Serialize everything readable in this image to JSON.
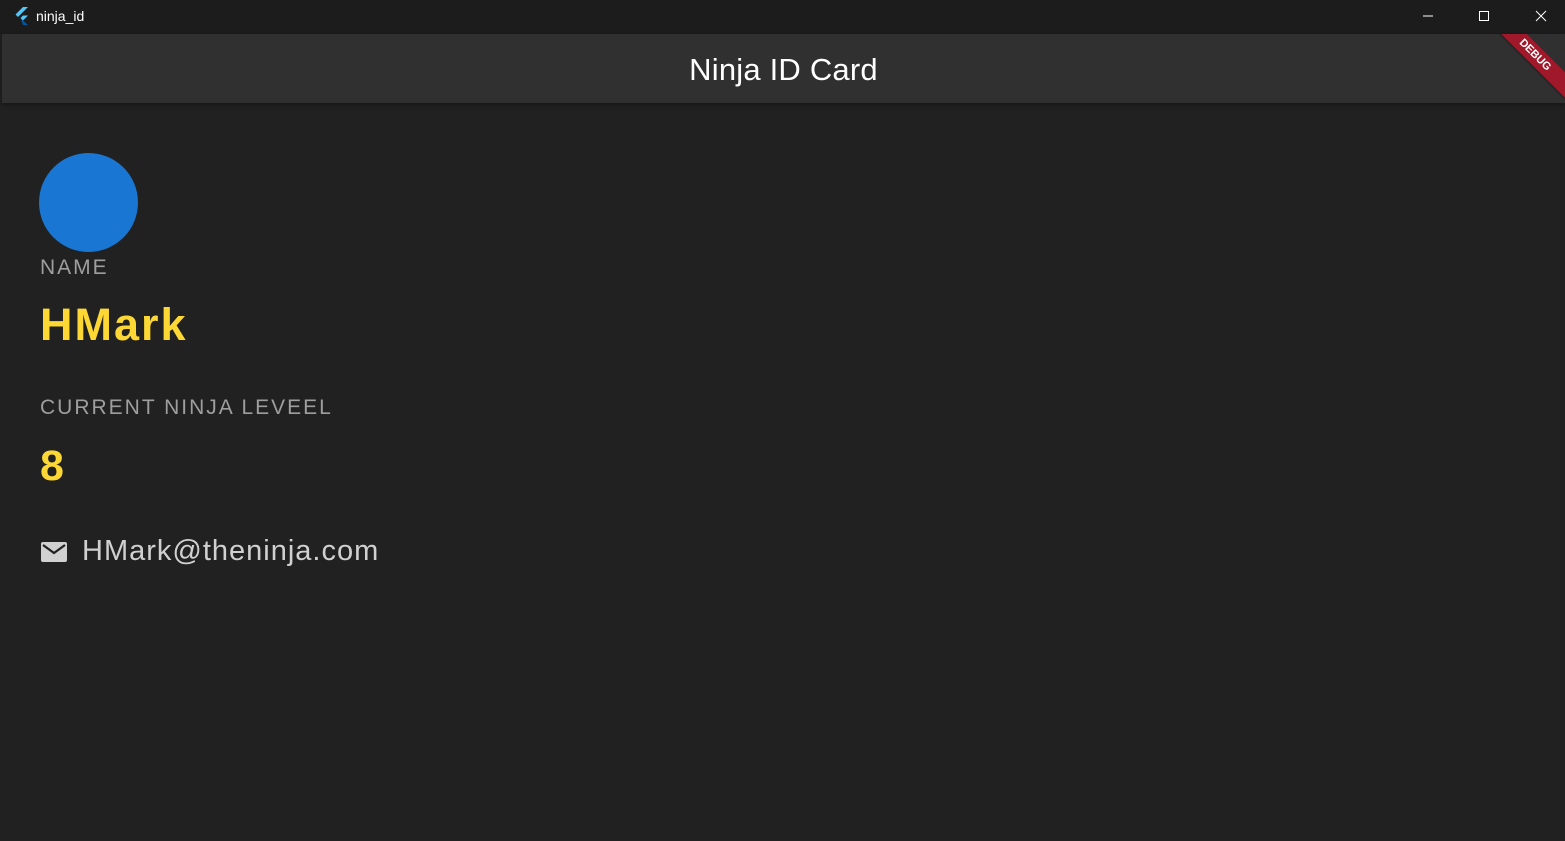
{
  "window": {
    "title": "ninja_id",
    "icons": {
      "app": "flutter-logo-icon",
      "minimize": "minimize-icon",
      "maximize": "maximize-icon",
      "close": "close-icon"
    }
  },
  "appbar": {
    "title": "Ninja ID Card",
    "debug_banner": "DEBUG"
  },
  "card": {
    "name_label": "NAME",
    "name_value": "HMark",
    "level_label": "CURRENT NINJA LEVEEL",
    "level_value": "8",
    "email": "HMark@theninja.com",
    "email_icon": "mail-icon"
  },
  "colors": {
    "background": "#212121",
    "appbar": "#303030",
    "avatar": "#1976d2",
    "accent_value": "#fdd835",
    "label": "#9e9e9e",
    "debug_banner": "#a0192b"
  }
}
